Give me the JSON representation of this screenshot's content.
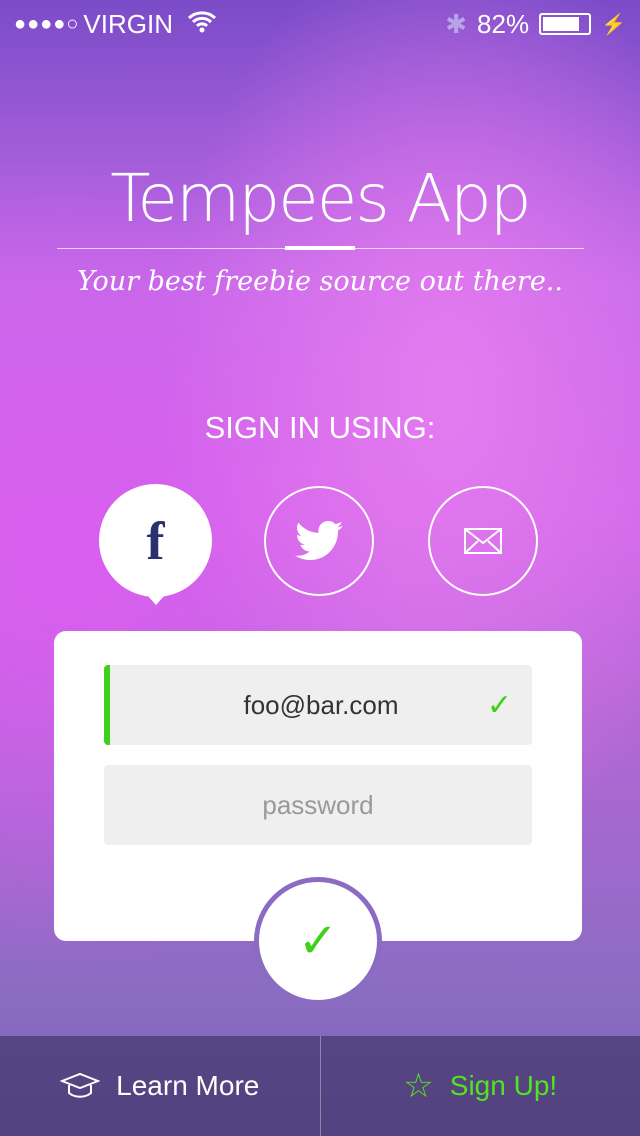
{
  "status": {
    "signal": "●●●●○",
    "carrier": "VIRGIN",
    "battery": "82%",
    "battery_level": 0.82
  },
  "header": {
    "title": "Tempees App",
    "tagline": "Your best freebie source out there.."
  },
  "signin": {
    "label": "SIGN IN USING:",
    "options": [
      "facebook-icon",
      "twitter-icon",
      "mail-icon"
    ]
  },
  "form": {
    "email_value": "foo@bar.com",
    "password_placeholder": "password",
    "accent": "#3dd11a"
  },
  "footer": {
    "learn_more": "Learn More",
    "sign_up": "Sign Up!"
  }
}
